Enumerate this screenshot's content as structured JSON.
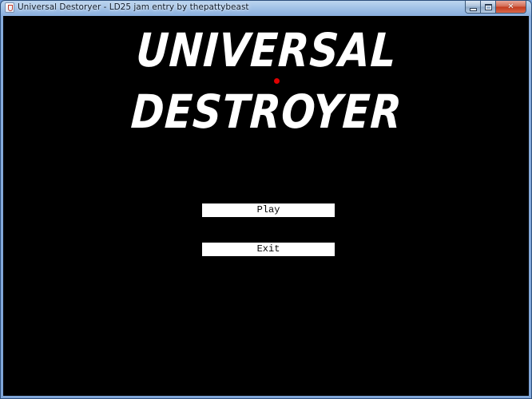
{
  "window": {
    "title": "Universal Destoryer - LD25 jam entry by thepattybeast",
    "close_glyph": "✕"
  },
  "game": {
    "logo_line_1": "UNIVERSAL",
    "logo_line_2": "DESTROYER",
    "accent_color": "#e00000",
    "background_color": "#000000"
  },
  "menu": {
    "play_label": "Play",
    "exit_label": "Exit"
  }
}
